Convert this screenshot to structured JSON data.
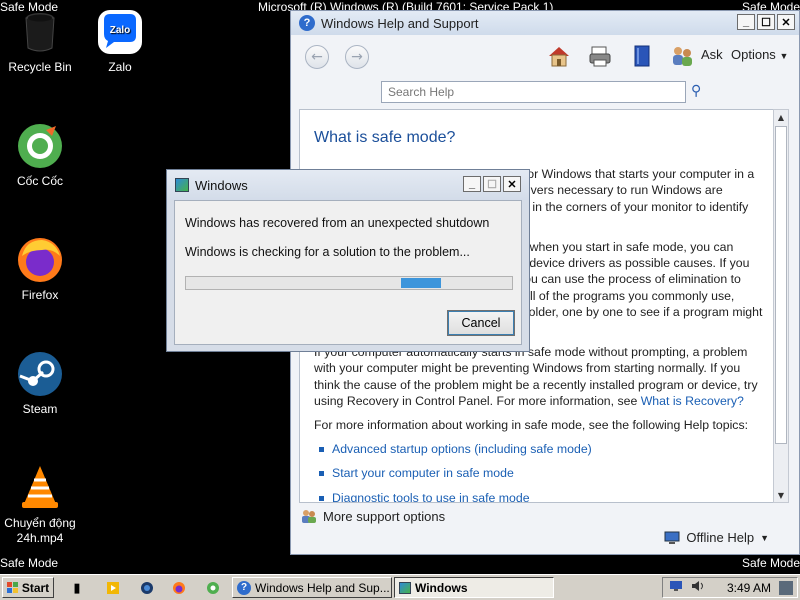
{
  "desktop": {
    "corner_top_left": "Safe Mode",
    "corner_top_right": "Safe Mode",
    "corner_bottom_left": "Safe Mode",
    "corner_bottom_right": "Safe Mode",
    "build_text": "Microsoft (R) Windows (R) (Build 7601: Service Pack 1)",
    "icons": [
      {
        "label": "Recycle Bin",
        "icon": "recycle-bin-icon"
      },
      {
        "label": "Zalo",
        "icon": "zalo-icon"
      },
      {
        "label": "Cốc Cốc",
        "icon": "coccoc-icon"
      },
      {
        "label": "Firefox",
        "icon": "firefox-icon"
      },
      {
        "label": "Steam",
        "icon": "steam-icon"
      },
      {
        "label": "Chuyển động 24h.mp4",
        "icon": "vlc-icon"
      }
    ]
  },
  "help_window": {
    "title": "Windows Help and Support",
    "toolbar": {
      "ask": "Ask",
      "options": "Options"
    },
    "search_placeholder": "Search Help",
    "content": {
      "heading": "What is safe mode?",
      "p1": "Safe mode is a troubleshooting option for Windows that starts your computer in a limited state. Only the basic files and drivers necessary to run Windows are started. The words \"Safe Mode\" appear in the corners of your monitor to identify which Windows mode you're using.",
      "p2": "If an existing problem doesn't reappear when you start in safe mode, you can eliminate the default settings and basic device drivers as possible causes. If you don't know the cause of the problem, you can use the process of elimination to help you find the problem. Try starting all of the programs you commonly use, including the programs in your Startup folder, one by one to see if a program might be the cause of the problem.",
      "p3_prefix": "If your computer automatically starts in safe mode without prompting, a problem with your computer might be preventing Windows from starting normally. If you think the cause of the problem might be a recently installed program or device, try using Recovery in Control Panel. For more information, see ",
      "p3_link": "What is Recovery?",
      "p4": "For more information about working in safe mode, see the following Help topics:",
      "links": [
        "Advanced startup options (including safe mode)",
        "Start your computer in safe mode",
        "Diagnostic tools to use in safe mode"
      ]
    },
    "more_support": "More support options",
    "offline_help": "Offline Help"
  },
  "dialog": {
    "title": "Windows",
    "message1": "Windows has recovered from an unexpected shutdown",
    "message2": "Windows is checking for a solution to the problem...",
    "cancel_label": "Cancel"
  },
  "taskbar": {
    "start_label": "Start",
    "tasks": [
      {
        "label": "Windows Help and Sup...",
        "active": false
      },
      {
        "label": "Windows",
        "active": true
      }
    ],
    "clock": "3:49 AM"
  }
}
